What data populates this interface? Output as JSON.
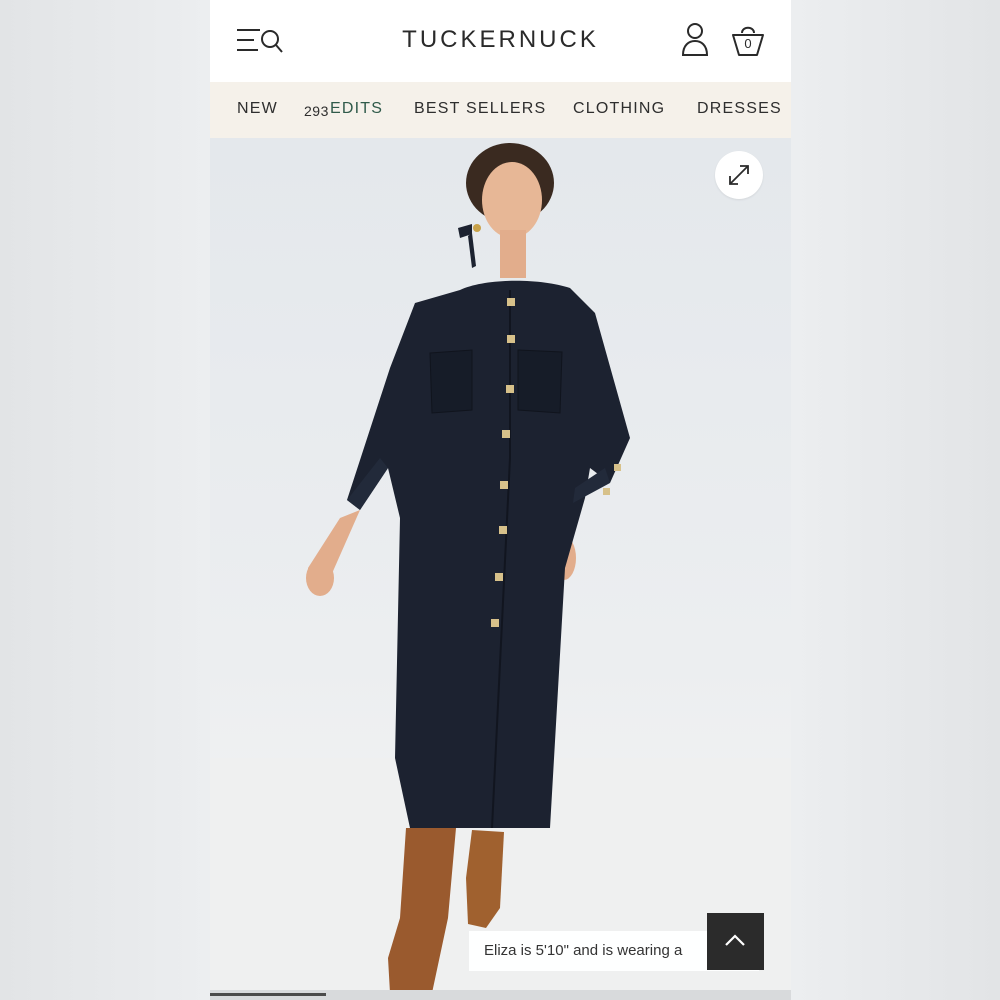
{
  "header": {
    "brand": "TUCKERNUCK",
    "bag_count": "0",
    "icons": [
      "menu-search-icon",
      "account-icon",
      "bag-icon"
    ]
  },
  "nav": {
    "items": [
      {
        "label": "NEW",
        "badge": "293"
      },
      {
        "label": "EDITS",
        "color": "#2f5a4a"
      },
      {
        "label": "BEST SELLERS"
      },
      {
        "label": "CLOTHING"
      },
      {
        "label": "DRESSES"
      }
    ]
  },
  "product_image": {
    "icons": [
      "expand-icon"
    ]
  },
  "caption": {
    "text": "Eliza is 5'10\" and is wearing a"
  },
  "scroll_top": {
    "icon": "chevron-up-icon"
  },
  "gallery": {
    "progress_fraction": 0.2
  },
  "colors": {
    "nav_background": "#f5f1ea",
    "dress": "#1c2230",
    "boots": "#9a5a2e",
    "accent_edits": "#2f5a4a",
    "scroll_button": "#2b2b2b"
  }
}
